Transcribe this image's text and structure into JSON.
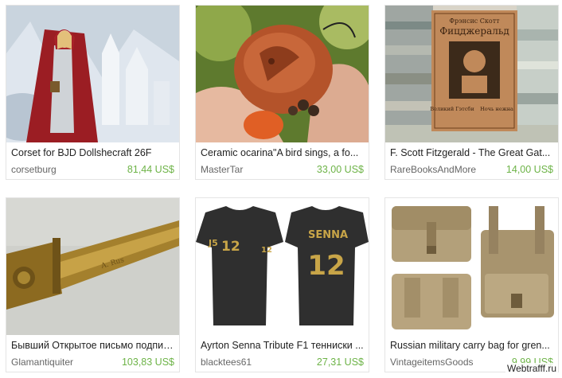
{
  "products": [
    {
      "title": "Corset for BJD Dollshecraft 26F",
      "shop": "corsetburg",
      "price": "81,44 US$",
      "image_icon": "doll-red-cloak-image"
    },
    {
      "title": "Ceramic ocarina\"A bird sings, a fo...",
      "shop": "MasterTar",
      "price": "33,00 US$",
      "image_icon": "ceramic-ocarina-image"
    },
    {
      "title": "F. Scott Fitzgerald - The Great Gat...",
      "shop": "RareBooksAndMore",
      "price": "14,00 US$",
      "image_icon": "book-cover-image",
      "book_text": {
        "author": "Фрэнсис Скотт",
        "name": "Фицджеральд",
        "title_left": "Великий Гэтсби",
        "title_right": "Ночь нежна"
      }
    },
    {
      "title": "Бывший Открытое письмо подписа...",
      "shop": "Glamantiquiter",
      "price": "103,83 US$",
      "image_icon": "letter-opener-image"
    },
    {
      "title": "Ayrton Senna Tribute F1 тенниски ...",
      "shop": "blacktees61",
      "price": "27,31 US$",
      "image_icon": "tshirts-image",
      "tshirt_text": {
        "number": "12",
        "name": "SENNA"
      }
    },
    {
      "title": "Russian military carry bag for gren...",
      "shop": "VintageitemsGoods",
      "price": "9,99 US$",
      "image_icon": "military-bag-image"
    }
  ],
  "watermark": "Webtrafff.ru",
  "colors": {
    "price": "#6db347",
    "title": "#222222",
    "shop": "#666666"
  }
}
